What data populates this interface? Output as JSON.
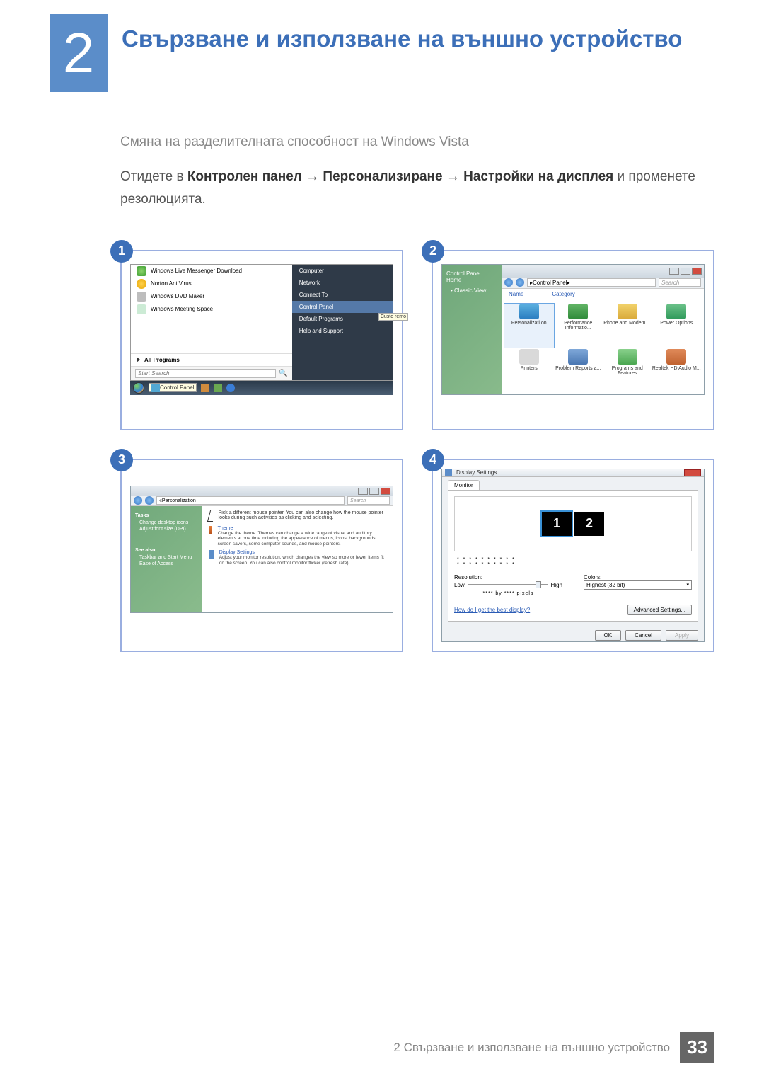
{
  "chapter": {
    "number": "2",
    "title": "Свързване и използване на външно устройство"
  },
  "section": {
    "subtitle": "Смяна на разделителната способност на Windows Vista"
  },
  "instruction": {
    "prefix": "Отидете в ",
    "b1": "Контролен панел",
    "arrow": "→",
    "b2": "Персонализиране",
    "b3": "Настройки на дисплея",
    "suffix": " и променете резолюцията."
  },
  "panels": {
    "n1": "1",
    "n2": "2",
    "n3": "3",
    "n4": "4"
  },
  "startmenu": {
    "items": {
      "msgr": "Windows Live Messenger Download",
      "norton": "Norton AntiVirus",
      "dvd": "Windows DVD Maker",
      "meeting": "Windows Meeting Space"
    },
    "all_programs": "All Programs",
    "search_placeholder": "Start Search",
    "right": {
      "computer": "Computer",
      "network": "Network",
      "connect": "Connect To",
      "control": "Control Panel",
      "defaults": "Default Programs",
      "defaults_tt": "Custo remo",
      "help": "Help and Support"
    },
    "taskbar_tip": "Control Panel"
  },
  "controlpanel": {
    "addr": "Control Panel",
    "search": "Search",
    "side": {
      "home": "Control Panel Home",
      "classic": "Classic View"
    },
    "cols": {
      "name": "Name",
      "category": "Category"
    },
    "items": {
      "personal": "Personalizati on",
      "perf": "Performance Informatio...",
      "phone": "Phone and Modem ...",
      "power": "Power Options",
      "printers": "Printers",
      "problem": "Problem Reports a...",
      "programs": "Programs and Features",
      "audio": "Realtek HD Audio M..."
    }
  },
  "personalize": {
    "addr": "Personalization",
    "search": "Search",
    "side": {
      "tasks": "Tasks",
      "l1": "Change desktop icons",
      "l2": "Adjust font size (DPI)",
      "seealso": "See also",
      "l3": "Taskbar and Start Menu",
      "l4": "Ease of Access"
    },
    "lead": "Pick a different mouse pointer. You can also change how the mouse pointer looks during such activities as clicking and selecting.",
    "theme_t": "Theme",
    "theme_d": "Change the theme. Themes can change a wide range of visual and auditory elements at one time including the appearance of menus, icons, backgrounds, screen savers, some computer sounds, and mouse pointers.",
    "disp_t": "Display Settings",
    "disp_d": "Adjust your monitor resolution, which changes the view so more or fewer items fit on the screen. You can also control monitor flicker (refresh rate)."
  },
  "display": {
    "title": "Display Settings",
    "tab": "Monitor",
    "mon1": "1",
    "mon2": "2",
    "stars": "* * * * * * * * * *\n* * * * * * * * * *",
    "res_lbl": "Resolution:",
    "low": "Low",
    "high": "High",
    "pixels": "**** by **** pixels",
    "colors_lbl": "Colors:",
    "colors_val": "Highest (32 bit)",
    "link": "How do I get the best display?",
    "adv": "Advanced Settings...",
    "ok": "OK",
    "cancel": "Cancel",
    "apply": "Apply"
  },
  "footer": {
    "text": "2 Свързване и използване на външно устройство",
    "page": "33"
  }
}
